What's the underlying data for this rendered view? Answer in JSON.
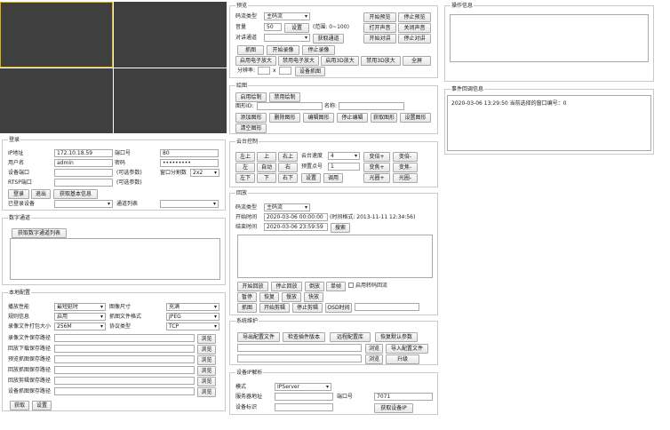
{
  "login": {
    "title": "登录",
    "ip_label": "IP地址",
    "ip": "172.10.18.59",
    "port_label": "端口号",
    "port": "80",
    "user_label": "用户名",
    "user": "admin",
    "pwd_label": "密码",
    "pwd": "•••••••••",
    "devport_label": "设备端口",
    "devport_hint": "(可选参数)",
    "split_label": "窗口分割数",
    "split": "2x2",
    "rtsp_label": "RTSP端口",
    "rtsp_hint": "(可选参数)",
    "login_btn": "登录",
    "logout_btn": "退出",
    "getinfo_btn": "获取基本信息",
    "logged_label": "已登录设备",
    "logged": "",
    "channel_label": "通道列表",
    "channel": ""
  },
  "digital": {
    "title": "数字通道",
    "get_btn": "获取数字通道列表"
  },
  "local": {
    "title": "本地配置",
    "perf_label": "播放性能",
    "perf": "最短延时",
    "size_label": "图像尺寸",
    "size": "充满",
    "rule_label": "规则信息",
    "rule": "启用",
    "fmt_label": "抓图文件格式",
    "fmt": "JPEG",
    "pack_label": "录像文件打包大小",
    "pack": "256M",
    "proto_label": "协议类型",
    "proto": "TCP",
    "paths": [
      {
        "label": "录像文件保存路径",
        "btn": "浏览"
      },
      {
        "label": "回放下载保存路径",
        "btn": "浏览"
      },
      {
        "label": "预览抓图保存路径",
        "btn": "浏览"
      },
      {
        "label": "回放抓图保存路径",
        "btn": "浏览"
      },
      {
        "label": "回放剪辑保存路径",
        "btn": "浏览"
      },
      {
        "label": "设备抓图保存路径",
        "btn": "浏览"
      }
    ],
    "get_btn": "获取",
    "set_btn": "设置"
  },
  "preview": {
    "title": "预览",
    "stream_label": "码流类型",
    "stream": "主码流",
    "vol_label": "音量",
    "vol": "50",
    "vol_set": "设置",
    "vol_hint": "(范围: 0~100)",
    "talk_label": "对讲通道",
    "talk": "",
    "get_talk_btn": "获取通道",
    "start_btn": "开始预览",
    "stop_btn": "停止预览",
    "open_sound": "打开声音",
    "close_sound": "关闭声音",
    "start_talk": "开始对讲",
    "stop_talk": "停止对讲",
    "capture": "抓图",
    "start_rec": "开始录像",
    "stop_rec": "停止录像",
    "ezoom_on": "启用电子放大",
    "ezoom_off": "禁用电子放大",
    "zoom3d_on": "启用3D放大",
    "zoom3d_off": "禁用3D放大",
    "fullscreen": "全屏",
    "res_label": "分辨率:",
    "res_x": "x",
    "dev_capture": "设备抓图"
  },
  "draw": {
    "title": "绘图",
    "enable": "启用绘制",
    "disable": "禁用绘制",
    "id_label": "图形ID:",
    "name_label": "名称:",
    "add": "添加图形",
    "del": "删除图形",
    "edit": "编辑图形",
    "stop_edit": "停止编辑",
    "get": "获取图形",
    "set": "设置图形",
    "clear": "清空图形"
  },
  "ptz": {
    "title": "云台控制",
    "up_left": "左上",
    "up": "上",
    "up_right": "右上",
    "speed_label": "云台速度",
    "speed": "4",
    "zoom_in": "变倍+",
    "zoom_out": "变倍-",
    "left": "左",
    "auto": "自动",
    "right": "右",
    "preset_label": "预置点号",
    "preset": "1",
    "focus_in": "变焦+",
    "focus_out": "变焦-",
    "down_left": "左下",
    "down": "下",
    "down_right": "右下",
    "set": "设置",
    "call": "调用",
    "iris_in": "光圈+",
    "iris_out": "光圈-"
  },
  "playback": {
    "title": "回放",
    "stream_label": "码流类型",
    "stream": "主码流",
    "start_label": "开始时间",
    "start": "2020-03-06 00:00:00",
    "time_hint": "(时间格式: 2013-11-11 12:34:56)",
    "end_label": "结束时间",
    "end": "2020-03-06 23:59:59",
    "search": "搜索",
    "start_pb": "开始回放",
    "stop_pb": "停止回放",
    "reverse": "倒放",
    "single": "单帧",
    "enable_transcode": "启用转码回流",
    "pause": "暂停",
    "resume": "恢复",
    "slow": "慢放",
    "fast": "快放",
    "capture": "抓图",
    "start_clip": "开始剪辑",
    "stop_clip": "停止剪辑",
    "osd": "OSD时间"
  },
  "maint": {
    "title": "系统维护",
    "export": "导出配置文件",
    "check": "检查插件版本",
    "remote": "远程配置库",
    "restore": "恢复默认参数",
    "browse1": "浏览",
    "import": "导入配置文件",
    "browse2": "浏览",
    "upgrade": "升级"
  },
  "ip": {
    "title": "设备IP解析",
    "mode_label": "模式",
    "mode": "IPServer",
    "server_label": "服务器地址",
    "port_label": "端口号",
    "port": "7071",
    "id_label": "设备标识",
    "get": "获取设备IP"
  },
  "ops": {
    "title": "操作信息"
  },
  "events": {
    "title": "事件回调信息",
    "log": "2020-03-06 13:29:50 当前选择的窗口编号：0"
  }
}
